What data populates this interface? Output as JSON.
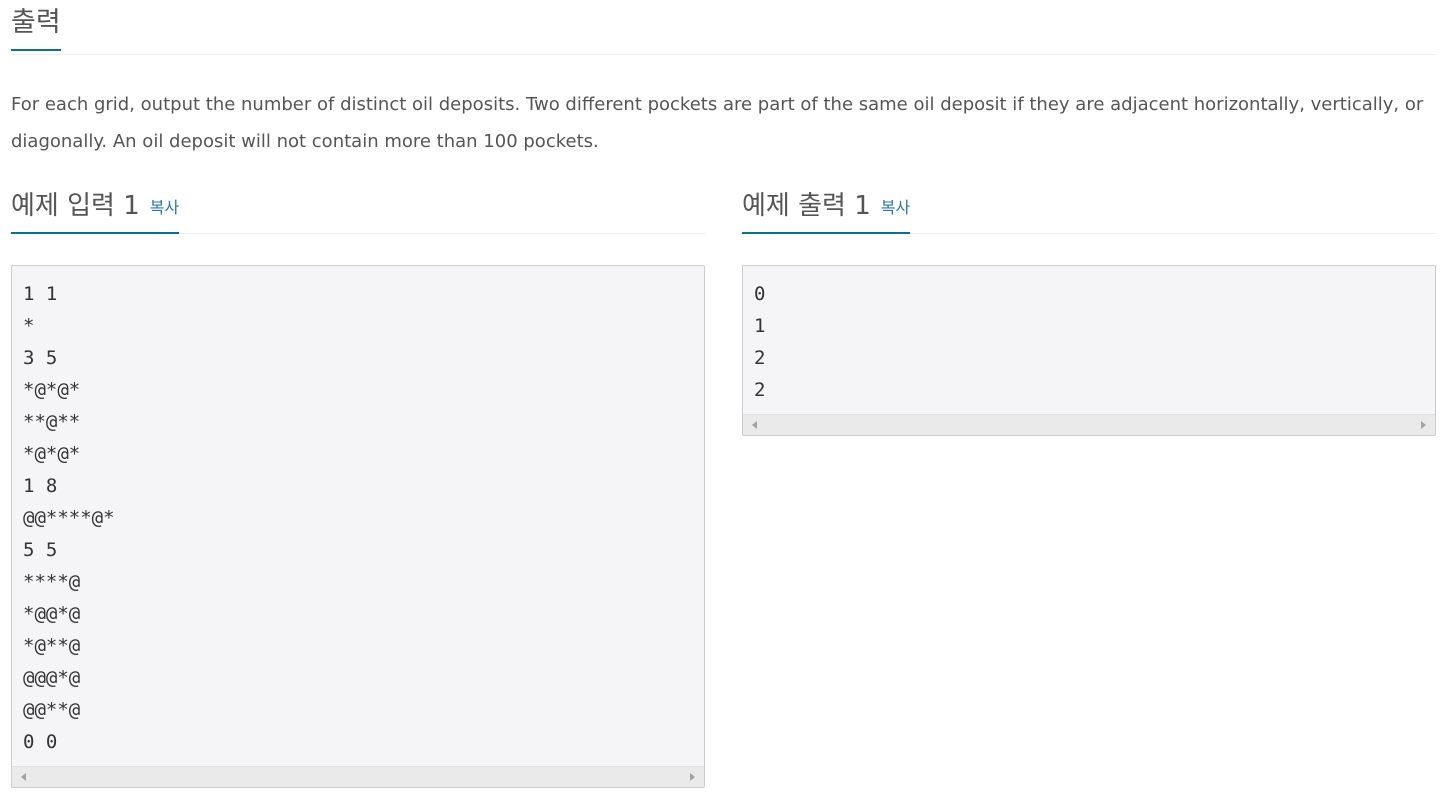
{
  "output_section": {
    "title": "출력",
    "description": "For each grid, output the number of distinct oil deposits. Two different pockets are part of the same oil deposit if they are adjacent horizontally, vertically, or diagonally. An oil deposit will not contain more than 100 pockets."
  },
  "sample_input": {
    "title": "예제 입력 1",
    "copy_label": "복사",
    "content": "1 1\n*\n3 5\n*@*@*\n**@**\n*@*@*\n1 8\n@@****@*\n5 5\n****@\n*@@*@\n*@**@\n@@@*@\n@@**@\n0 0"
  },
  "sample_output": {
    "title": "예제 출력 1",
    "copy_label": "복사",
    "content": "0\n1\n2\n2"
  },
  "colors": {
    "accent_underline": "#0e6f87",
    "copy_link": "#2a78a6",
    "code_background": "#f5f5f7"
  }
}
